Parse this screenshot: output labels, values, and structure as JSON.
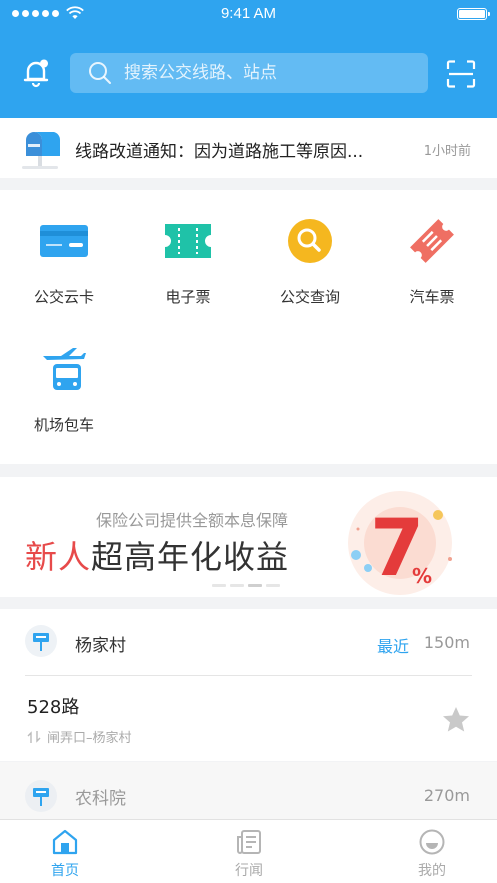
{
  "status_bar": {
    "time": "9:41 AM"
  },
  "header": {
    "search_placeholder": "搜索公交线路、站点",
    "accent_color": "#2fa4ef"
  },
  "notice": {
    "text": "线路改道通知：因为道路施工等原因...",
    "time": "1小时前"
  },
  "services": [
    {
      "label": "公交云卡",
      "icon": "bus-card-icon"
    },
    {
      "label": "电子票",
      "icon": "e-ticket-icon"
    },
    {
      "label": "公交查询",
      "icon": "bus-search-icon"
    },
    {
      "label": "汽车票",
      "icon": "coach-ticket-icon"
    },
    {
      "label": "机场包车",
      "icon": "airport-shuttle-icon"
    }
  ],
  "banner": {
    "subtitle": "保险公司提供全额本息保障",
    "title_highlight": "新人",
    "title_rest": "超高年化收益",
    "rate_number": "7",
    "rate_unit": "%"
  },
  "nearby": [
    {
      "stop": "杨家村",
      "tag": "最近",
      "distance": "150m",
      "route": {
        "name": "528路",
        "direction": "闸弄口–杨家村"
      }
    },
    {
      "stop": "农科院",
      "distance": "270m"
    }
  ],
  "tabs": [
    {
      "label": "首页",
      "icon": "home-icon",
      "active": true
    },
    {
      "label": "行闻",
      "icon": "news-icon",
      "active": false
    },
    {
      "label": "我的",
      "icon": "profile-icon",
      "active": false
    }
  ]
}
